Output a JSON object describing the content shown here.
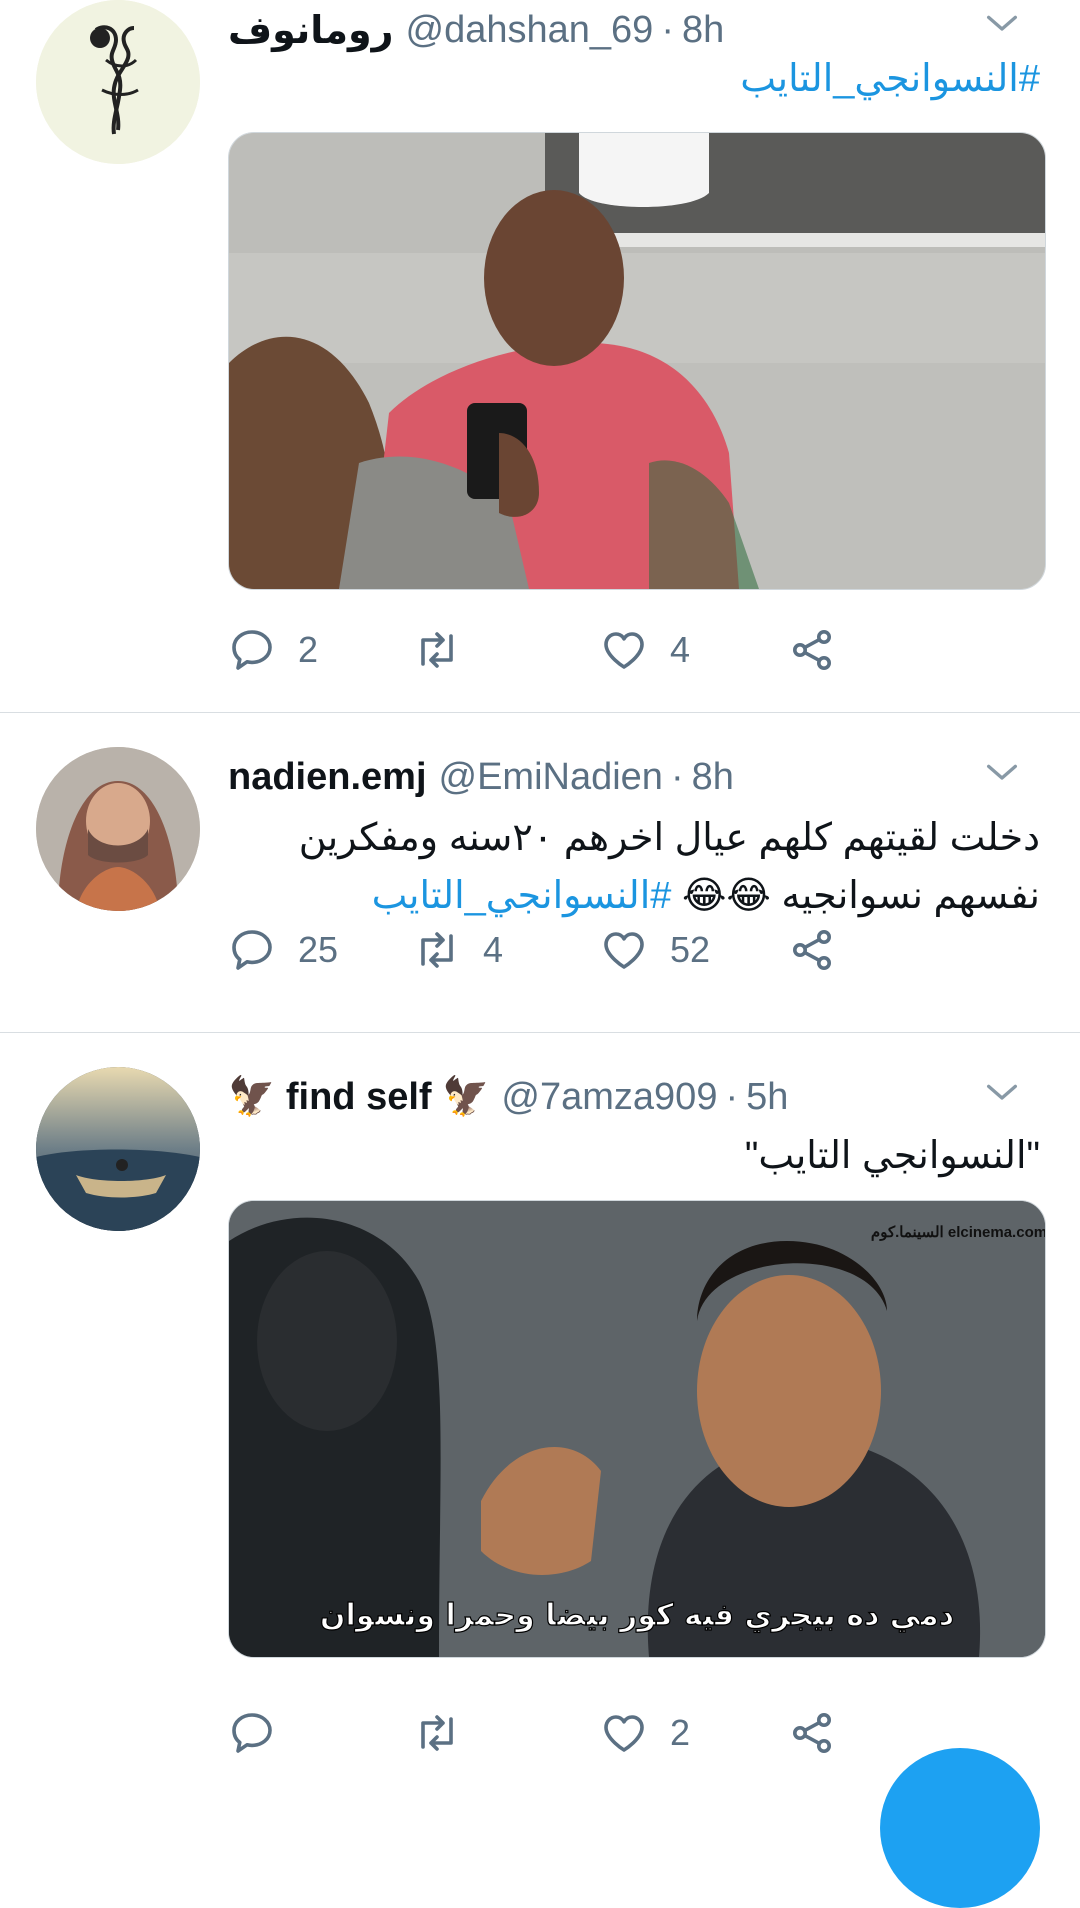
{
  "tweets": [
    {
      "name": "رومانوف",
      "handle": "@dahshan_69",
      "time": "8h",
      "text_lines": [],
      "hashtag": "#النسوانجي_التايب",
      "reply_count": "2",
      "retweet_count": "",
      "like_count": "4"
    },
    {
      "name": "nadien.emj",
      "handle": "@EmiNadien",
      "time": "8h",
      "text_lines": [
        "دخلت لقيتهم كلهم عيال اخرهم ٢٠سنه ومفكرين",
        "نفسهم نسوانجيه 😂😂"
      ],
      "hashtag": "#النسوانجي_التايب",
      "reply_count": "25",
      "retweet_count": "4",
      "like_count": "52"
    },
    {
      "name": "🦅 find self 🦅",
      "handle": "@7amza909",
      "time": "5h",
      "text_lines": [
        "\"النسوانجي التايب\""
      ],
      "reply_count": "",
      "retweet_count": "",
      "like_count": "2",
      "media_watermark": "السينما.كوم elcinema.com",
      "media_subtitle": "دمي ده بيجري فيه كور بيضا وحمرا ونسوان"
    }
  ],
  "separator": "·",
  "icons": [
    "chevron-down-icon",
    "reply-icon",
    "retweet-icon",
    "like-icon",
    "share-icon",
    "compose-icon"
  ],
  "colors": {
    "link": "#1b95e0",
    "secondary": "#5b7083",
    "divider": "#d9dee2",
    "fab": "#1da1f2"
  }
}
